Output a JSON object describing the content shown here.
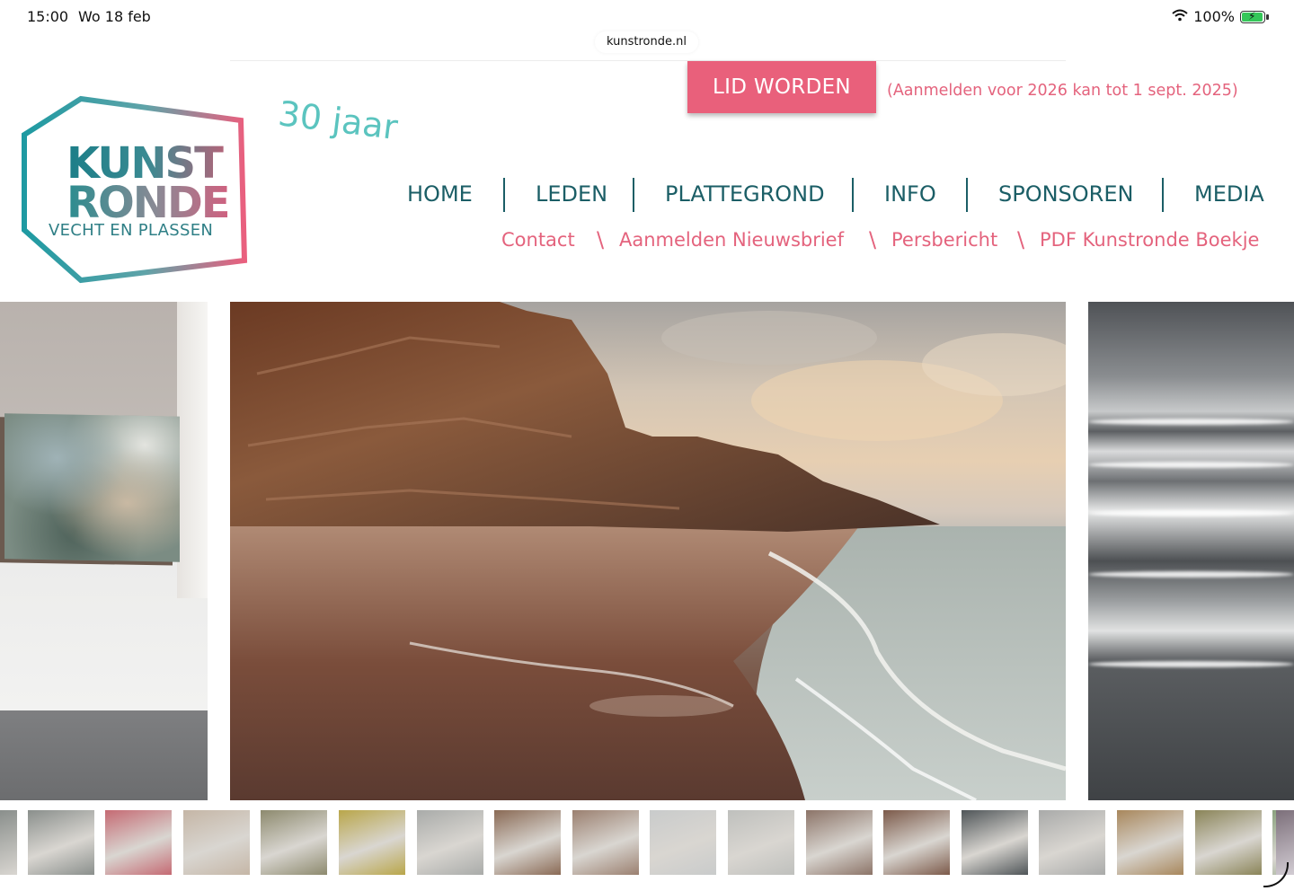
{
  "status_bar": {
    "time": "15:00",
    "date": "Wo 18 feb",
    "battery_label": "100%",
    "battery_level": 100,
    "wifi_icon": "wifi-icon",
    "battery_icon": "battery-charging-icon"
  },
  "browser": {
    "url": "kunstronde.nl"
  },
  "logo": {
    "line1": "KUNST",
    "line2": "RONDE",
    "subtitle": "VECHT EN PLASSEN",
    "colors": {
      "teal": "#1c8c96",
      "pink": "#e9607b"
    }
  },
  "jubilee": "30 jaar",
  "cta": {
    "label": "LID WORDEN",
    "note": "(Aanmelden voor 2026 kan tot 1 sept. 2025)",
    "color": "#e9607b"
  },
  "nav": {
    "items": [
      "HOME",
      "LEDEN",
      "PLATTEGROND",
      "INFO",
      "SPONSOREN",
      "MEDIA"
    ],
    "color": "#1b5e66"
  },
  "subnav": {
    "items": [
      "Contact",
      "Aanmelden Nieuwsbrief",
      "Persbericht",
      "PDF Kunstronde Boekje"
    ],
    "separator": "\\",
    "color": "#e4637d"
  },
  "carousel": {
    "slides": [
      "painting-small-abstract",
      "painting-cliff-beach",
      "painting-stormy-sea"
    ],
    "active_index": 1
  },
  "thumbnails": {
    "count": 17,
    "colors": [
      "#8a8f8c",
      "#c56a73",
      "#c5b6a6",
      "#8d8a6e",
      "#b9a64a",
      "#a9aba9",
      "#8a6a55",
      "#9b8070",
      "#c9cbcb",
      "#bfc0bd",
      "#8c7468",
      "#7c5a4a",
      "#4f5558",
      "#a9aaa9",
      "#a8875c",
      "#8a8458",
      "#8aa27e"
    ]
  }
}
